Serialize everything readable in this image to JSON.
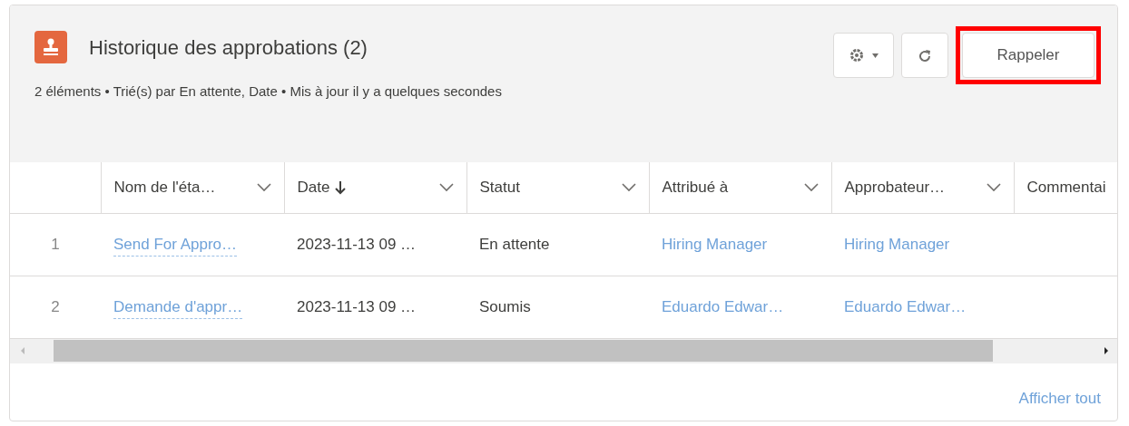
{
  "card": {
    "title": "Historique des approbations (2)",
    "subtitle": "2 éléments • Trié(s) par En attente, Date • Mis à jour il y a quelques secondes"
  },
  "toolbar": {
    "recall_button": {
      "label": "Rappeler",
      "highlighted": true
    }
  },
  "table": {
    "columns": [
      {
        "label": "Nom de l'éta…",
        "sorted": false,
        "menu": true
      },
      {
        "label": "Date",
        "sorted": true,
        "menu": true
      },
      {
        "label": "Statut",
        "sorted": false,
        "menu": true
      },
      {
        "label": "Attribué à",
        "sorted": false,
        "menu": true
      },
      {
        "label": "Approbateur…",
        "sorted": false,
        "menu": true
      },
      {
        "label": "Commentai",
        "sorted": false
      }
    ],
    "rows": [
      {
        "number": "1",
        "cells": [
          {
            "text": "Send For Appro…",
            "kind": "link"
          },
          {
            "text": "2023-11-13 09 …",
            "kind": "text"
          },
          {
            "text": "En attente",
            "kind": "text"
          },
          {
            "text": "Hiring Manager",
            "kind": "link"
          },
          {
            "text": "Hiring Manager",
            "kind": "link"
          },
          {
            "kind": "empty"
          }
        ]
      },
      {
        "number": "2",
        "cells": [
          {
            "text": "Demande d'appr…",
            "kind": "link"
          },
          {
            "text": "2023-11-13 09 …",
            "kind": "text"
          },
          {
            "text": "Soumis",
            "kind": "text"
          },
          {
            "text": "Eduardo Edwar…",
            "kind": "link"
          },
          {
            "text": "Eduardo Edwar…",
            "kind": "link"
          },
          {
            "kind": "empty"
          }
        ]
      }
    ]
  },
  "footer": {
    "link": "Afficher tout"
  }
}
